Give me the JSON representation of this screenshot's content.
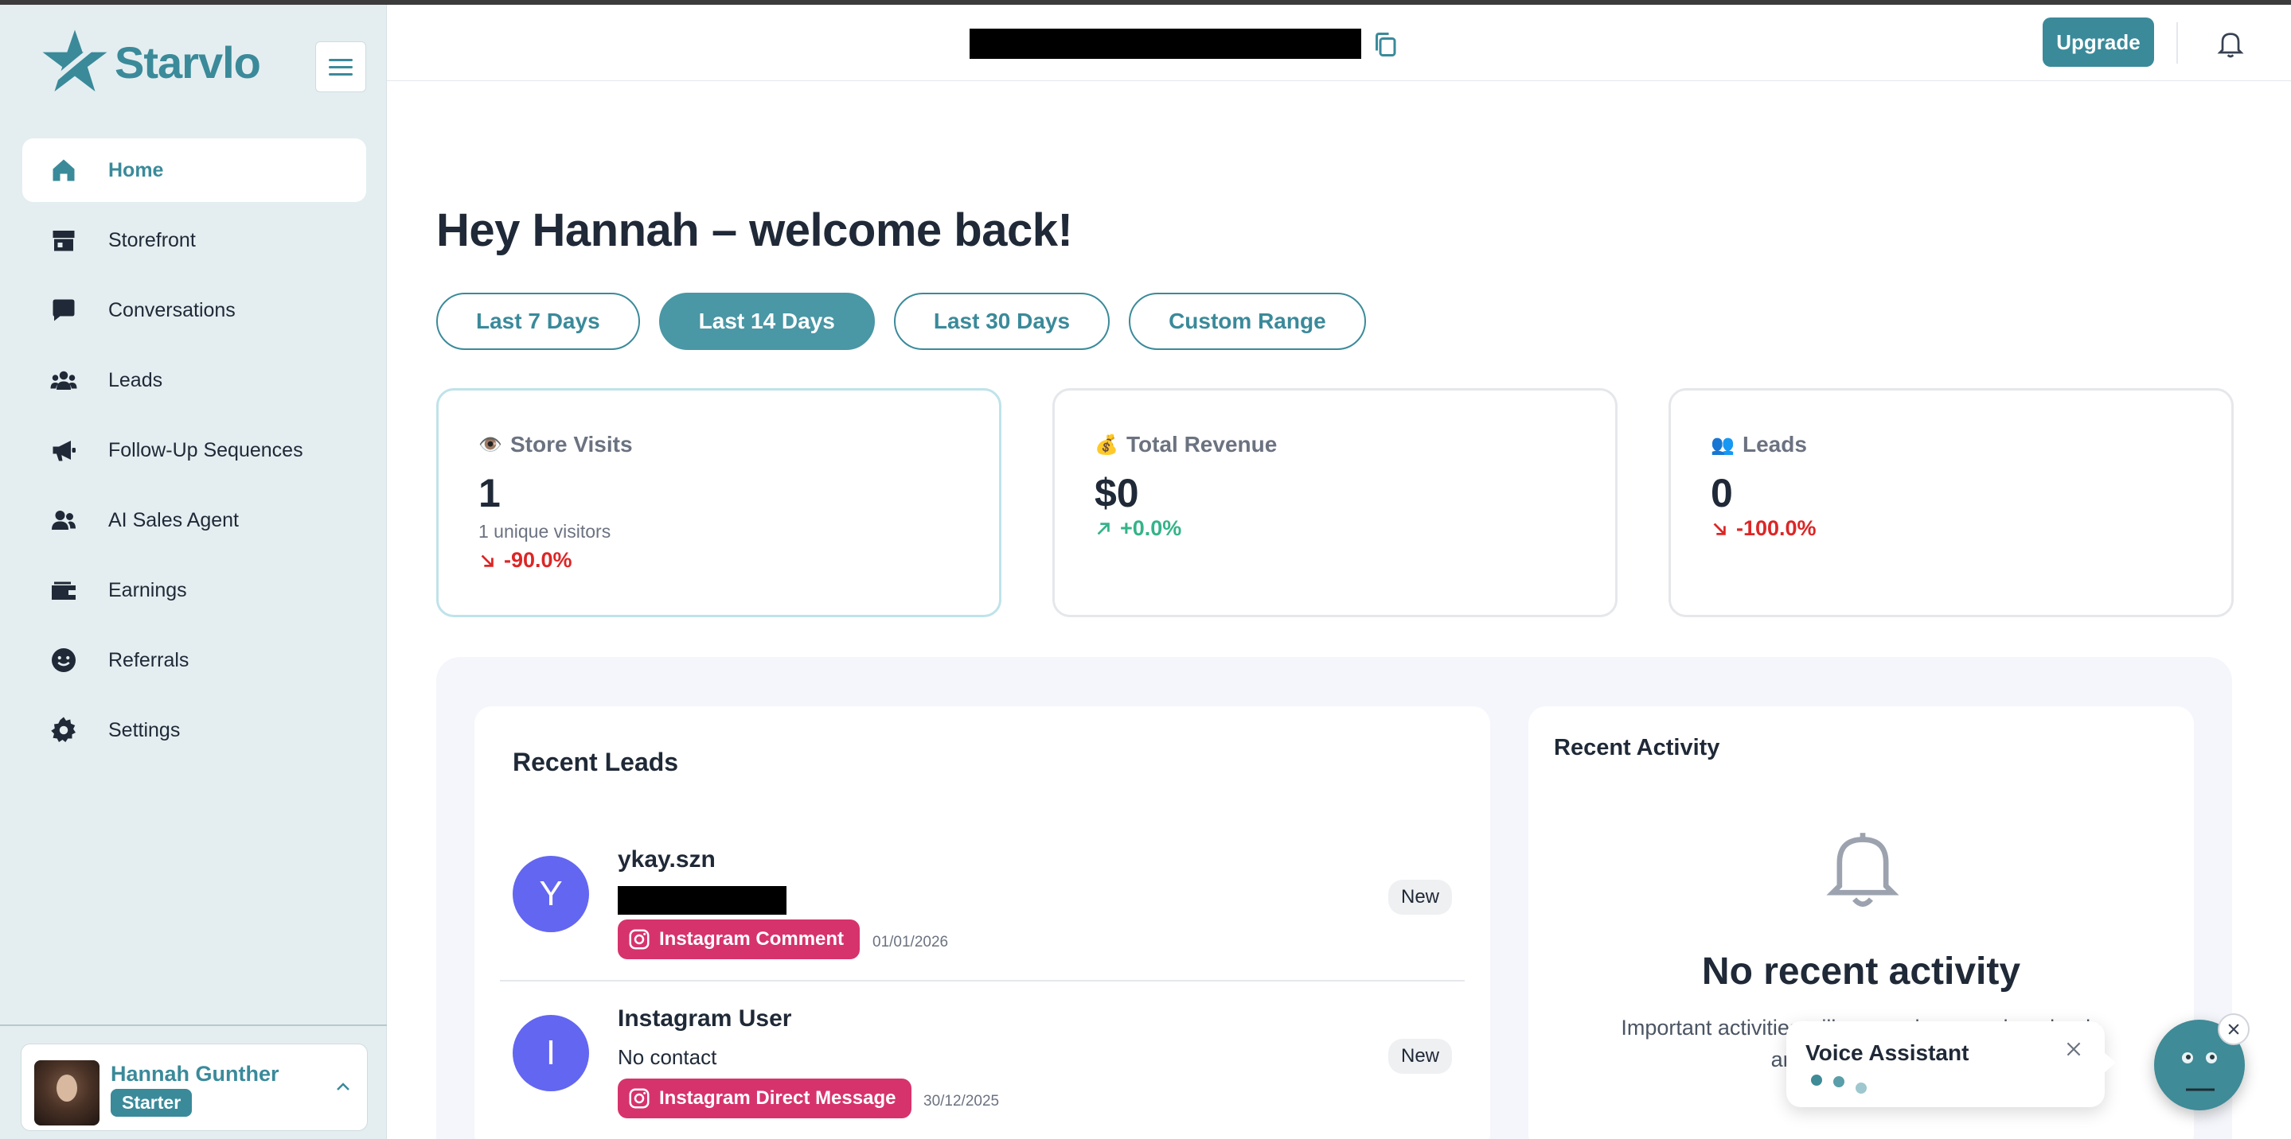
{
  "brand": {
    "name": "Starvlo"
  },
  "sidebar": {
    "items": [
      {
        "label": "Home",
        "icon": "home-icon",
        "active": true
      },
      {
        "label": "Storefront",
        "icon": "storefront-icon",
        "active": false
      },
      {
        "label": "Conversations",
        "icon": "chat-bubble-icon",
        "active": false
      },
      {
        "label": "Leads",
        "icon": "users-icon",
        "active": false
      },
      {
        "label": "Follow-Up Sequences",
        "icon": "megaphone-icon",
        "active": false
      },
      {
        "label": "AI Sales Agent",
        "icon": "user-group-icon",
        "active": false
      },
      {
        "label": "Earnings",
        "icon": "wallet-icon",
        "active": false
      },
      {
        "label": "Referrals",
        "icon": "smile-icon",
        "active": false
      },
      {
        "label": "Settings",
        "icon": "gear-icon",
        "active": false
      }
    ],
    "user": {
      "name": "Hannah Gunther",
      "plan": "Starter"
    }
  },
  "header": {
    "upgrade_label": "Upgrade"
  },
  "main": {
    "greeting": "Hey Hannah – welcome back!",
    "ranges": [
      {
        "label": "Last 7 Days",
        "active": false
      },
      {
        "label": "Last 14 Days",
        "active": true
      },
      {
        "label": "Last 30 Days",
        "active": false
      },
      {
        "label": "Custom Range",
        "active": false
      }
    ],
    "stats": [
      {
        "emoji": "👁️",
        "title": "Store Visits",
        "value": "1",
        "sub": "1 unique visitors",
        "change": "-90.0%",
        "direction": "down"
      },
      {
        "emoji": "💰",
        "title": "Total Revenue",
        "value": "$0",
        "sub": "",
        "change": "+0.0%",
        "direction": "up"
      },
      {
        "emoji": "👥",
        "title": "Leads",
        "value": "0",
        "sub": "",
        "change": "-100.0%",
        "direction": "down"
      }
    ],
    "recent_leads": {
      "title": "Recent Leads",
      "items": [
        {
          "initial": "Y",
          "name": "ykay.szn",
          "contact": "",
          "source": "Instagram Comment",
          "date": "01/01/2026",
          "badge": "New"
        },
        {
          "initial": "I",
          "name": "Instagram User",
          "contact": "No contact",
          "source": "Instagram Direct Message",
          "date": "30/12/2025",
          "badge": "New"
        }
      ]
    },
    "recent_activity": {
      "title": "Recent Activity",
      "empty_title": "No recent activity",
      "empty_desc": "Important activities will appear here, such as leads and conversations."
    }
  },
  "voice_assistant": {
    "title": "Voice Assistant"
  },
  "colors": {
    "accent": "#3a8a9a",
    "sidebar_bg": "#e4eef0",
    "danger": "#dc2626",
    "success": "#34b38a",
    "instagram": "#d6336c",
    "lead_avatar": "#6366f1"
  }
}
